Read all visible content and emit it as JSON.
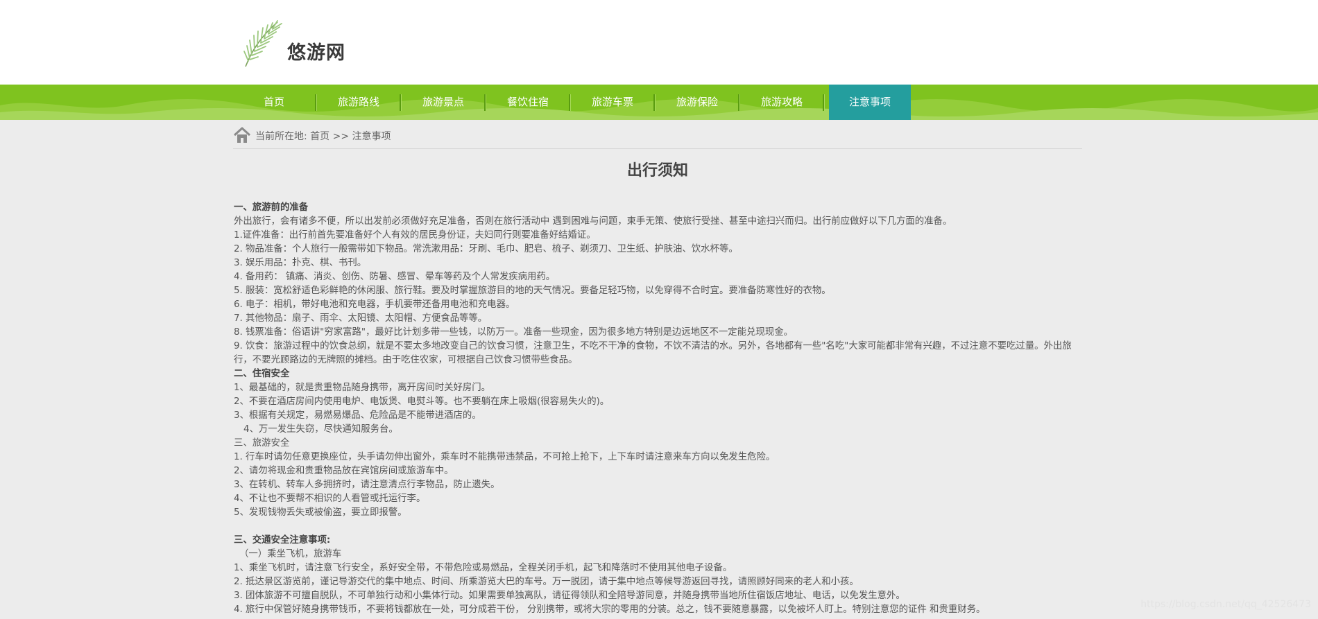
{
  "site": {
    "name": "悠游网"
  },
  "nav": {
    "items": [
      "首页",
      "旅游路线",
      "旅游景点",
      "餐饮住宿",
      "旅游车票",
      "旅游保险",
      "旅游攻略",
      "注意事项"
    ],
    "active_index": 7,
    "colors": {
      "bar": "#7fc31f",
      "active": "#249e9e"
    }
  },
  "breadcrumb": {
    "label": "当前所在地:",
    "path": "首页 >> 注意事项"
  },
  "article": {
    "title": "出行须知",
    "lines": [
      "一、旅游前的准备",
      "外出旅行，会有诸多不便，所以出发前必须做好充足准备，否则在旅行活动中 遇到困难与问题，束手无策、使旅行受挫、甚至中途扫兴而归。出行前应做好以下几方面的准备。",
      "1.证件准备：出行前首先要准备好个人有效的居民身份证，夫妇同行则要准备好结婚证。",
      "2. 物品准备：个人旅行一般需带如下物品。常洗漱用品：牙刷、毛巾、肥皂、梳子、剃须刀、卫生纸、护肤油、饮水杯等。",
      "3. 娱乐用品：扑克、棋、书刊。",
      "4. 备用药： 镇痛、消炎、创伤、防暑、感冒、晕车等药及个人常发疾病用药。",
      "5. 服装：宽松舒适色彩鲜艳的休闲服、旅行鞋。要及时掌握旅游目的地的天气情况。要备足轻巧物，以免穿得不合时宜。要准备防寒性好的衣物。",
      "6. 电子：相机，带好电池和充电器，手机要带还备用电池和充电器。",
      "7. 其他物品：扇子、雨伞、太阳镜、太阳帽、方便食品等等。",
      "8. 钱票准备：俗语讲\"穷家富路\"，最好比计划多带一些钱，以防万一。准备一些现金，因为很多地方特别是边远地区不一定能兑现现金。",
      "9. 饮食：旅游过程中的饮食总纲，就是不要太多地改变自己的饮食习惯，注意卫生，不吃不干净的食物，不饮不清洁的水。另外，各地都有一些\"名吃\"大家可能都非常有兴趣，不过注意不要吃过量。外出旅行，不要光顾路边的无牌照的摊档。由于吃住农家，可根据自己饮食习惯带些食品。",
      "二、住宿安全",
      "1、最基础的，就是贵重物品随身携带，离开房间时关好房门。",
      "2、不要在酒店房间内使用电炉、电饭煲、电熨斗等。也不要躺在床上吸烟(很容易失火的)。",
      "3、根据有关规定，易燃易爆品、危险品是不能带进酒店的。",
      "4、万一发生失窃，尽快通知服务台。",
      "三、旅游安全",
      "1. 行车时请勿任意更换座位，头手请勿伸出窗外，乘车时不能携带违禁品，不可抢上抢下，上下车时请注意来车方向以免发生危险。",
      "2、请勿将现金和贵重物品放在宾馆房间或旅游车中。",
      "3、在转机、转车人多拥挤时，请注意清点行李物品，防止遗失。",
      "4、不让也不要帮不相识的人看管或托运行李。",
      "5、发现钱物丢失或被偷盗，要立即报警。",
      "三、交通安全注意事项:",
      "（一）乘坐飞机，旅游车",
      "1、乘坐飞机时，请注意飞行安全，系好安全带，不带危险或易燃品，全程关闭手机，起飞和降落时不使用其他电子设备。",
      "2. 抵达景区游览前，谨记导游交代的集中地点、时间、所乘游览大巴的车号。万一脱团，请于集中地点等候导游返回寻找，请照顾好同来的老人和小孩。",
      "3. 团体旅游不可擅自脱队，不可单独行动和小集体行动。如果需要单独离队，请征得领队和全陪导游同意，并随身携带当地所住宿饭店地址、电话，以免发生意外。",
      "4. 旅行中保管好随身携带钱币，不要将钱都放在一处，可分成若干份， 分别携带，或将大宗的零用的分装。总之，钱不要随意暴露，以免被坏人盯上。特别注意您的证件 和贵重财务。"
    ]
  },
  "watermark": "https://blog.csdn.net/qq_42526473"
}
